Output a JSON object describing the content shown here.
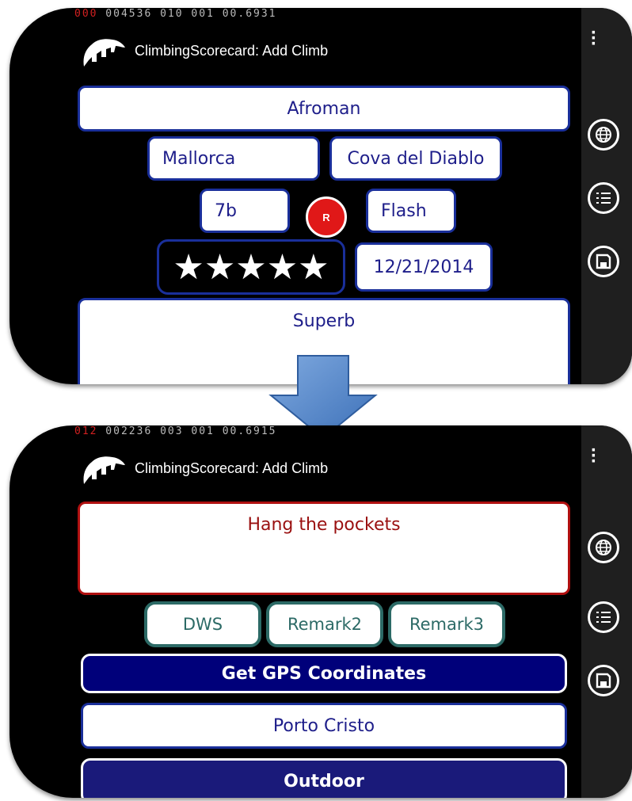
{
  "top_screen": {
    "debug_red": "000",
    "debug_rest": " 004536 010 001 00.6931",
    "title": "ClimbingScorecard: Add Climb",
    "route_name": "Afroman",
    "area": "Mallorca",
    "crag": "Cova del Diablo",
    "grade": "7b",
    "redpoint_badge": "R",
    "style": "Flash",
    "stars": "★★★★★",
    "date": "12/21/2014",
    "comment": "Superb"
  },
  "bottom_screen": {
    "debug_red": "012",
    "debug_rest": " 002236 003 001 00.6915",
    "title": "ClimbingScorecard: Add Climb",
    "comment": "Hang the pockets",
    "remarks": [
      "DWS",
      "Remark2",
      "Remark3"
    ],
    "gps_button": "Get GPS Coordinates",
    "location": "Porto Cristo",
    "setting_button": "Outdoor"
  },
  "colors": {
    "accent_dark_blue": "#00007a",
    "field_border": "#1a2f9a",
    "red_badge": "#e01818",
    "comment_red_border": "#b01010",
    "remark_teal": "#2c6a66"
  },
  "icons": {
    "appbar": [
      "globe-icon",
      "list-icon",
      "save-icon"
    ],
    "transition": "arrow-down-icon"
  }
}
